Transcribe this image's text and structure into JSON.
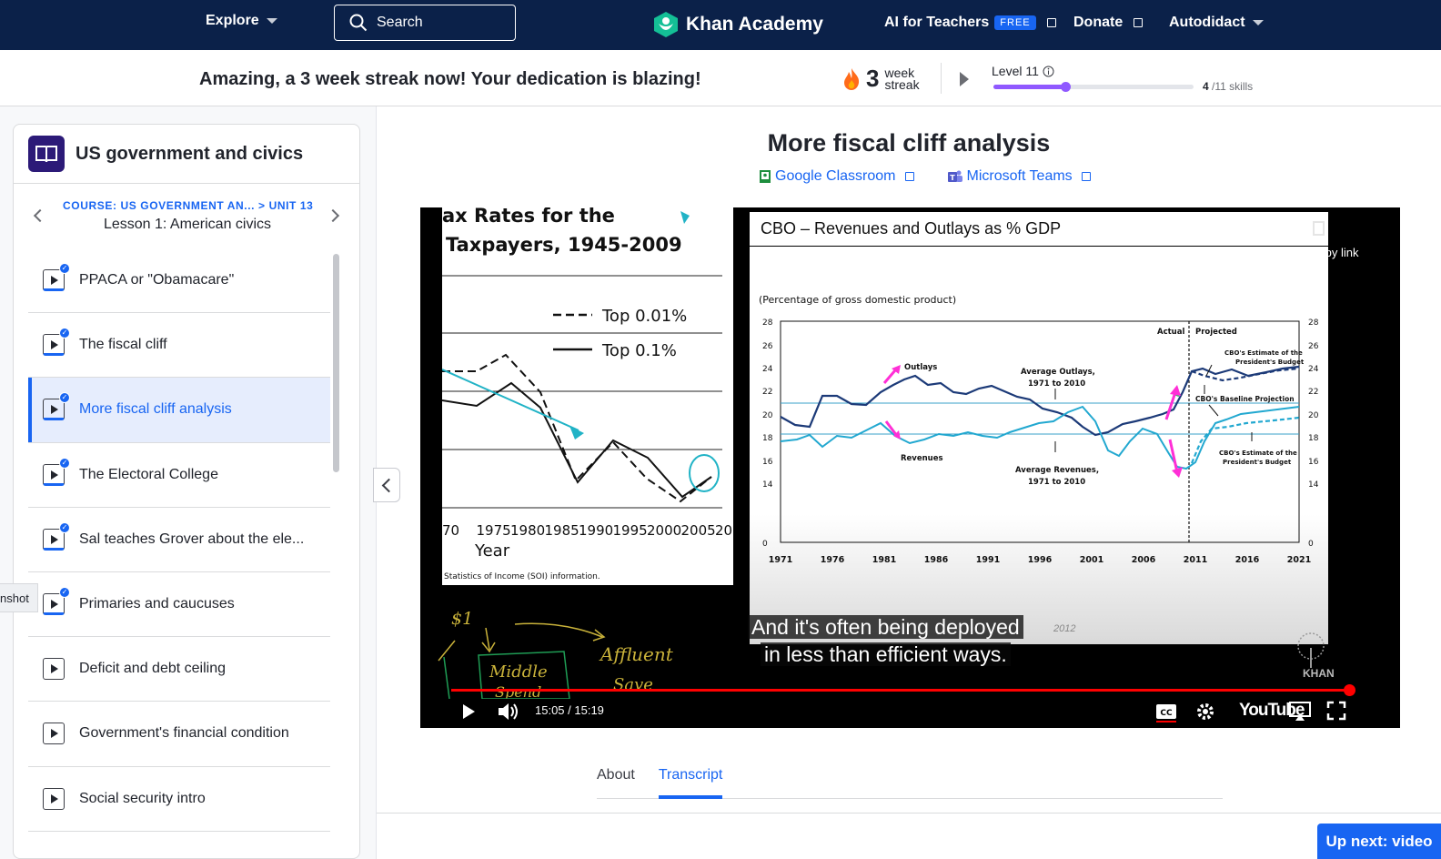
{
  "nav": {
    "explore": "Explore",
    "search_label": "Search",
    "logo": "Khan Academy",
    "ai": "AI for Teachers",
    "ai_badge": "FREE",
    "donate": "Donate",
    "user": "Autodidact"
  },
  "streak": {
    "message": "Amazing, a 3 week streak now! Your dedication is blazing!",
    "count": "3",
    "unit_line1": "week",
    "unit_line2": "streak",
    "level": "Level 11",
    "skills_done": "4",
    "skills_total": "/11 skills",
    "level_progress": 0.36
  },
  "sidebar": {
    "course": "US government and civics",
    "breadcrumb": "COURSE: US GOVERNMENT AN...  > UNIT 13",
    "lesson": "Lesson 1: American civics",
    "items": [
      {
        "label": "PPACA or \"Obamacare\"",
        "done": true
      },
      {
        "label": "The fiscal cliff",
        "done": true
      },
      {
        "label": "More fiscal cliff analysis",
        "done": true,
        "active": true
      },
      {
        "label": "The Electoral College",
        "done": true
      },
      {
        "label": "Sal teaches Grover about the ele...",
        "done": true
      },
      {
        "label": "Primaries and caucuses",
        "done": true
      },
      {
        "label": "Deficit and debt ceiling",
        "done": false
      },
      {
        "label": "Government's financial condition",
        "done": false
      },
      {
        "label": "Social security intro",
        "done": false
      }
    ],
    "screenshot_tab": "nshot"
  },
  "main": {
    "title": "More fiscal cliff analysis",
    "google_classroom": "Google Classroom",
    "microsoft_teams": "Microsoft Teams"
  },
  "video": {
    "left_title_line1": "ax Rates for the",
    "left_title_line2": "Taxpayers, 1945-2009",
    "legend_top001": "Top 0.01%",
    "legend_top01": "Top 0.1%",
    "left_xticks": [
      "70",
      "1975",
      "1980",
      "1985",
      "1990",
      "1995",
      "2000",
      "2005",
      "2010"
    ],
    "left_xlabel": "Year",
    "left_source": "Statistics of Income (SOI) information.",
    "cbo_title": "CBO – Revenues and Outlays as % GDP",
    "cbo_subtitle": "(Percentage of gross domestic product)",
    "cbo_yticks": [
      "28",
      "26",
      "24",
      "22",
      "20",
      "18",
      "16",
      "14",
      "0"
    ],
    "cbo_xticks": [
      "1971",
      "1976",
      "1981",
      "1986",
      "1991",
      "1996",
      "2001",
      "2006",
      "2011",
      "2016",
      "2021"
    ],
    "ann_actual": "Actual",
    "ann_projected": "Projected",
    "ann_outlays": "Outlays",
    "ann_revenues": "Revenues",
    "ann_avg_outlays_1": "Average Outlays,",
    "ann_avg_outlays_2": "1971 to 2010",
    "ann_avg_rev_1": "Average Revenues,",
    "ann_avg_rev_2": "1971 to 2010",
    "ann_cbo_est_1": "CBO's Estimate of the",
    "ann_cbo_est_2": "President's Budget",
    "ann_baseline": "CBO's Baseline Projection",
    "ann_date": "2012",
    "copy_link": "Copy link",
    "caption_line1": "And it's often being deployed",
    "caption_line2": "in less than efficient ways.",
    "handwriting": [
      "$1",
      "Middle",
      "Spend",
      "Affluent",
      "Save"
    ],
    "time": "15:05 / 15:19",
    "progress": 0.987,
    "youtube": "YouTube",
    "khan_wm": "KHAN"
  },
  "tabs": [
    "About",
    "Transcript"
  ],
  "upnext": "Up next: video"
}
